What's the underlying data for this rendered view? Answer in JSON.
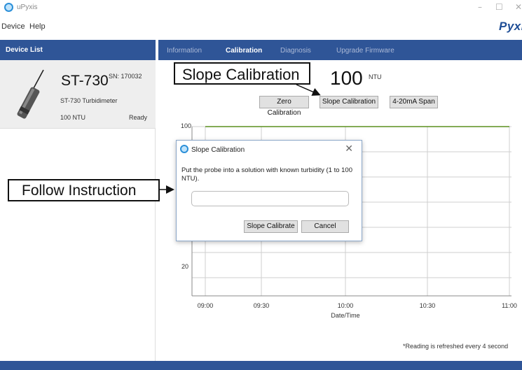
{
  "window": {
    "app_title": "uPyxis",
    "minimize": "–",
    "maximize": "☐",
    "close": "✕"
  },
  "menu": {
    "items": [
      "Device",
      "Help"
    ],
    "brand": "Pyxi"
  },
  "device_list": {
    "header": "Device List",
    "device": {
      "model": "ST-730",
      "serial": "SN: 170032",
      "name": "ST-730 Turbidimeter",
      "reading": "100 NTU",
      "status": "Ready"
    }
  },
  "tabs": [
    {
      "label": "Information",
      "active": false
    },
    {
      "label": "Calibration",
      "active": true
    },
    {
      "label": "Diagnosis",
      "active": false
    },
    {
      "label": "Upgrade Firmware",
      "active": false
    }
  ],
  "callouts": {
    "slope": "Slope Calibration",
    "follow": "Follow Instruction"
  },
  "reading": {
    "value": "100",
    "unit": "NTU"
  },
  "buttons": {
    "zero": "Zero Calibration",
    "slope": "Slope Calibration",
    "span": "4-20mA Span"
  },
  "chart_data": {
    "type": "line",
    "xlabel": "Date/Time",
    "ylabel": "",
    "x_ticks": [
      "09:00",
      "09:30",
      "10:00",
      "10:30",
      "11:00"
    ],
    "y_ticks_visible": [
      "100",
      "20"
    ],
    "series": [
      {
        "x": [
          "09:00",
          "09:30",
          "10:00",
          "10:30",
          "11:00"
        ],
        "values": [
          100,
          100,
          100,
          100,
          100
        ],
        "color": "#5a8f1e"
      }
    ]
  },
  "dialog": {
    "title": "Slope Calibration",
    "close": "✕",
    "message": "Put the probe into a solution with known turbidity (1 to 100 NTU).",
    "input_value": "",
    "confirm_label": "Slope Calibrate",
    "cancel_label": "Cancel"
  },
  "footnote": "*Reading is refreshed every 4 second",
  "colors": {
    "accent": "#2f5597",
    "series": "#5a8f1e"
  }
}
